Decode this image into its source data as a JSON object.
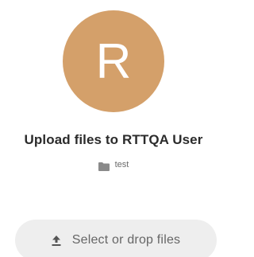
{
  "avatar": {
    "initial": "R",
    "color": "#D4A06A"
  },
  "header": {
    "title": "Upload files to RTTQA User"
  },
  "folder": {
    "icon": "folder-icon",
    "name": "test"
  },
  "upload": {
    "icon": "upload-icon",
    "label": "Select or drop files"
  }
}
